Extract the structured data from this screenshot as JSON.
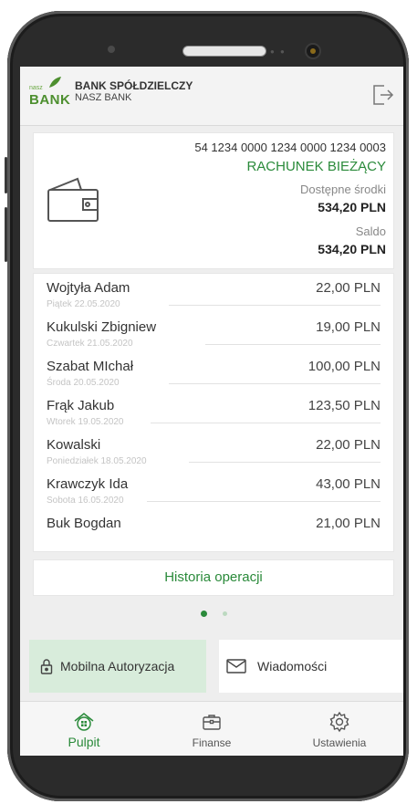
{
  "header": {
    "logo_small": "nasz",
    "logo_big": "BANK",
    "bank_name": "BANK SPÓŁDZIELCZY",
    "bank_sub": "NASZ BANK"
  },
  "account": {
    "number": "54 1234 0000 1234 0000 1234 0003",
    "type": "RACHUNEK BIEŻĄCY",
    "available_label": "Dostępne środki",
    "available_value": "534,20 PLN",
    "balance_label": "Saldo",
    "balance_value": "534,20 PLN"
  },
  "transactions": [
    {
      "name": "Wojtyła Adam",
      "date": "Piątek 22.05.2020",
      "amount": "22,00 PLN"
    },
    {
      "name": "Kukulski Zbigniew",
      "date": "Czwartek 21.05.2020",
      "amount": "19,00 PLN"
    },
    {
      "name": "Szabat MIchał",
      "date": "Środa 20.05.2020",
      "amount": "100,00 PLN"
    },
    {
      "name": "Frąk Jakub",
      "date": "Wtorek 19.05.2020",
      "amount": "123,50 PLN"
    },
    {
      "name": "Kowalski",
      "date": "Poniedziałek 18.05.2020",
      "amount": "22,00 PLN"
    },
    {
      "name": "Krawczyk Ida",
      "date": "Sobota 16.05.2020",
      "amount": "43,00 PLN"
    },
    {
      "name": "Buk Bogdan",
      "date": "",
      "amount": "21,00 PLN"
    }
  ],
  "history_label": "Historia operacji",
  "pager": {
    "active_color": "#2a8a3a",
    "inactive_color": "#bcd9c0"
  },
  "tiles": {
    "auth_label": "Mobilna Autoryzacja",
    "auth_icon": "lock-icon",
    "msg_label": "Wiadomości",
    "msg_icon": "envelope-icon"
  },
  "nav": {
    "desktop_label": "Pulpit",
    "finance_label": "Finanse",
    "settings_label": "Ustawienia"
  },
  "colors": {
    "accent": "#2a8a3a",
    "brand": "#4d8f2f",
    "tile_active": "#d8ecdb"
  }
}
